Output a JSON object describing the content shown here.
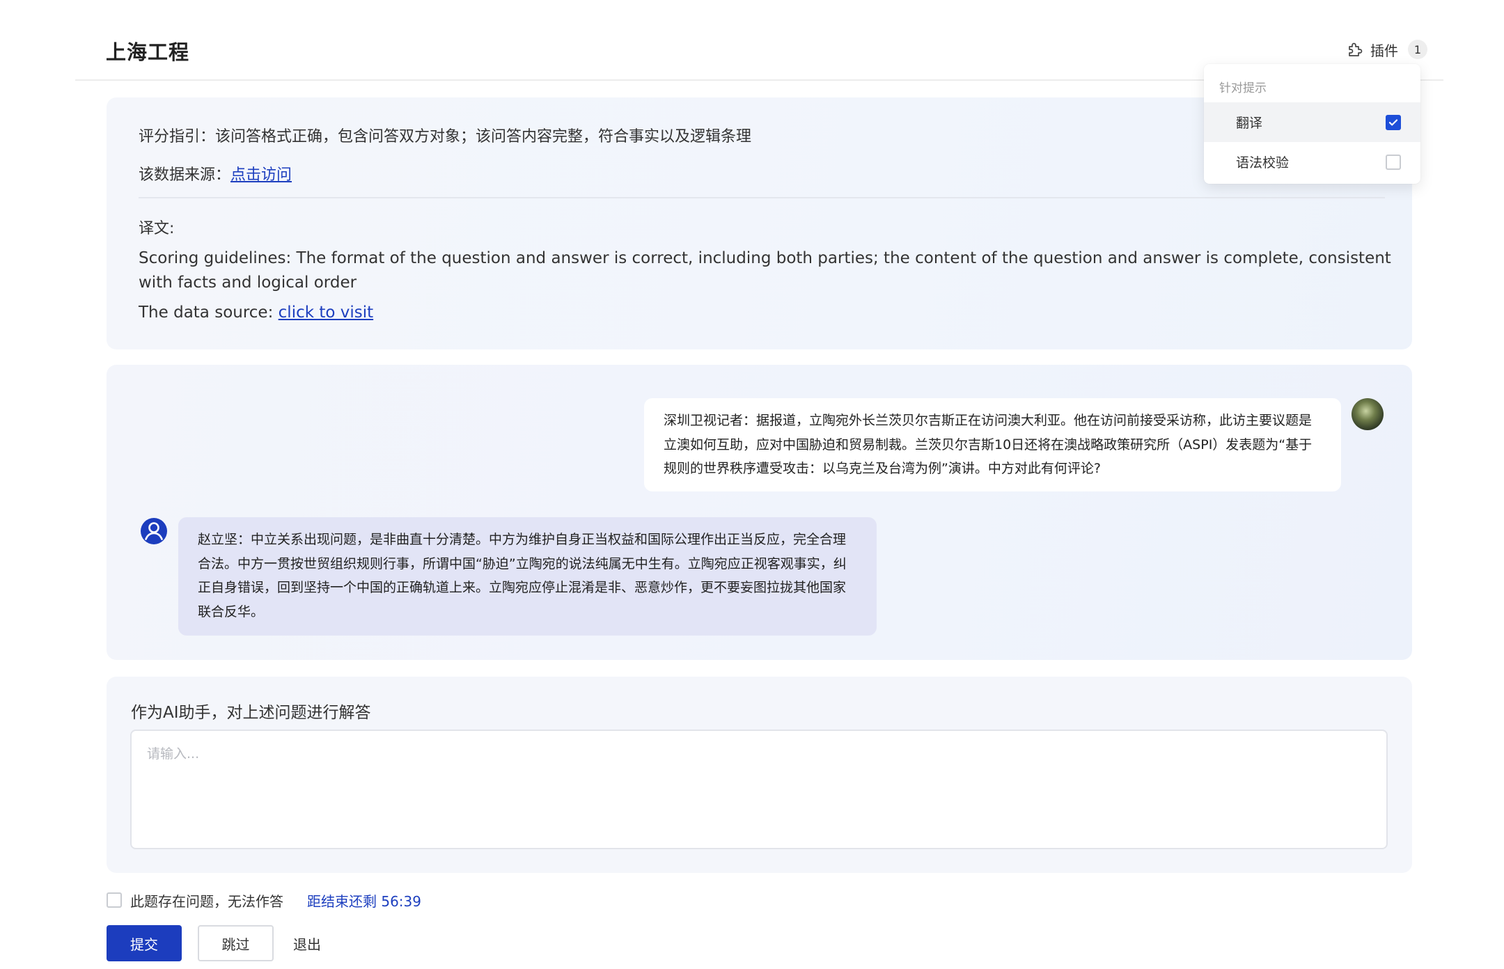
{
  "header": {
    "title": "上海工程",
    "plugin_label": "插件",
    "plugin_count": "1"
  },
  "plugin_dropdown": {
    "section_title": "针对提示",
    "options": [
      {
        "label": "翻译",
        "checked": true
      },
      {
        "label": "语法校验",
        "checked": false
      }
    ]
  },
  "guide": {
    "scoring_guideline": "评分指引：该问答格式正确，包含问答双方对象；该问答内容完整，符合事实以及逻辑条理",
    "source_prefix": "该数据来源：",
    "source_link": "点击访问",
    "translation_label": "译文:",
    "translation_text": "Scoring guidelines: The format of the question and answer is correct, including both parties; the content of the question and answer is complete, consistent with facts and logical order",
    "translation_source_prefix": "The data source: ",
    "translation_source_link": "click to visit"
  },
  "chat": {
    "question": "深圳卫视记者：据报道，立陶宛外长兰茨贝尔吉斯正在访问澳大利亚。他在访问前接受采访称，此访主要议题是立澳如何互助，应对中国胁迫和贸易制裁。兰茨贝尔吉斯10日还将在澳战略政策研究所（ASPI）发表题为“基于规则的世界秩序遭受攻击：以乌克兰及台湾为例”演讲。中方对此有何评论?",
    "answer": "赵立坚：中立关系出现问题，是非曲直十分清楚。中方为维护自身正当权益和国际公理作出正当反应，完全合理合法。中方一贯按世贸组织规则行事，所谓中国“胁迫”立陶宛的说法纯属无中生有。立陶宛应正视客观事实，纠正自身错误，回到坚持一个中国的正确轨道上来。立陶宛应停止混淆是非、恶意炒作，更不要妄图拉拢其他国家联合反华。"
  },
  "answer_box": {
    "label": "作为AI助手，对上述问题进行解答",
    "placeholder": "请输入..."
  },
  "footer": {
    "issue_label": "此题存在问题，无法作答",
    "timer_text": "距结束还剩 56:39",
    "submit_label": "提交",
    "skip_label": "跳过",
    "exit_label": "退出"
  },
  "colors": {
    "primary": "#1c3dbe",
    "link": "#1d3fbf",
    "answer_bubble": "#e2e4f6"
  }
}
